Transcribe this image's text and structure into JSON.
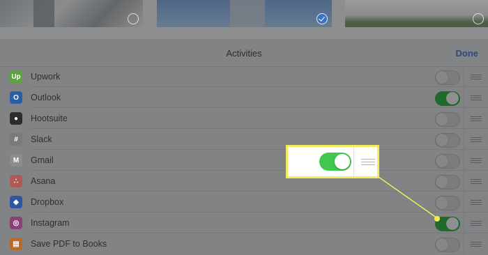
{
  "photos": [
    {
      "selected": false
    },
    {
      "selected": true
    },
    {
      "selected": false
    }
  ],
  "sheet": {
    "title": "Activities",
    "done_label": "Done"
  },
  "activities": [
    {
      "label": "Upwork",
      "icon": "upwork-icon",
      "icon_color": "#5aa53a",
      "enabled": false
    },
    {
      "label": "Outlook",
      "icon": "outlook-icon",
      "icon_color": "#2a5fa6",
      "enabled": true
    },
    {
      "label": "Hootsuite",
      "icon": "hootsuite-icon",
      "icon_color": "#2c2c2e",
      "enabled": false
    },
    {
      "label": "Slack",
      "icon": "slack-icon",
      "icon_color": "#7a7a7c",
      "enabled": false
    },
    {
      "label": "Gmail",
      "icon": "gmail-icon",
      "icon_color": "#8d8d8f",
      "enabled": false
    },
    {
      "label": "Asana",
      "icon": "asana-icon",
      "icon_color": "#b05a56",
      "enabled": false
    },
    {
      "label": "Dropbox",
      "icon": "dropbox-icon",
      "icon_color": "#2d57a1",
      "enabled": false
    },
    {
      "label": "Instagram",
      "icon": "instagram-icon",
      "icon_color": "#8a3f78",
      "enabled": true
    },
    {
      "label": "Save PDF to Books",
      "icon": "books-icon",
      "icon_color": "#b66b26",
      "enabled": false
    }
  ],
  "callout": {
    "toggle_enabled": true,
    "highlight_color": "#f2ec5b",
    "toggle_color": "#3fc74f"
  }
}
